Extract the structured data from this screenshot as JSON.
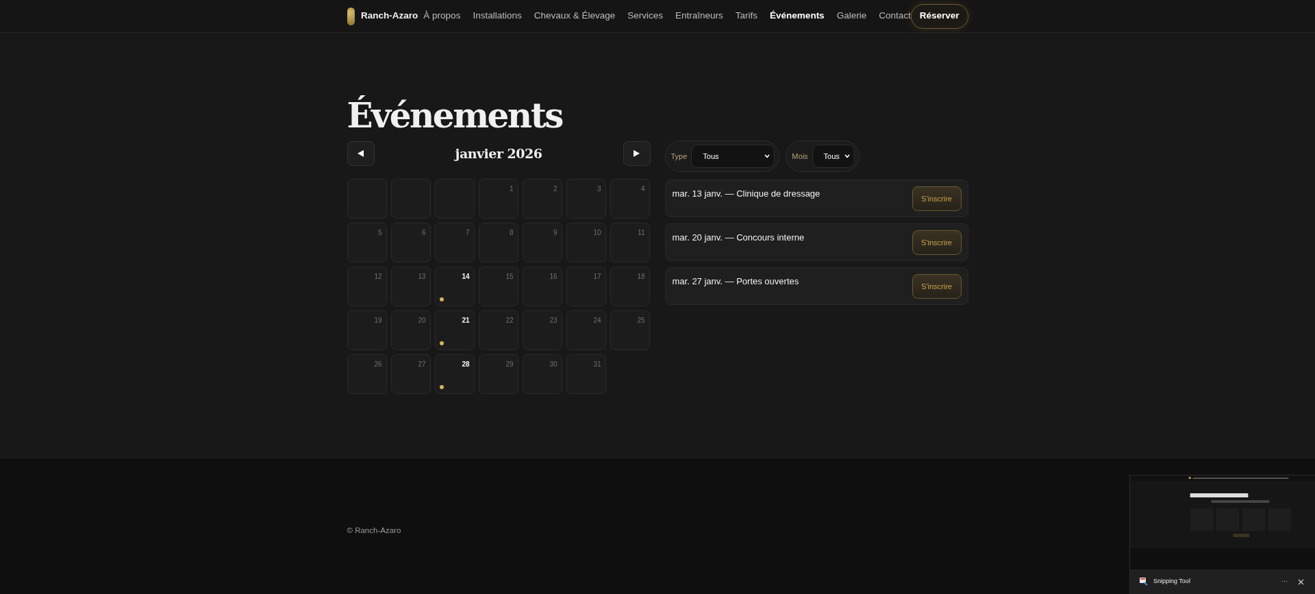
{
  "nav": {
    "brand": "Ranch-Azaro",
    "links": [
      {
        "label": "À propos",
        "selected": false
      },
      {
        "label": "Installations",
        "selected": false
      },
      {
        "label": "Chevaux & Élevage",
        "selected": false
      },
      {
        "label": "Services",
        "selected": false
      },
      {
        "label": "Entraîneurs",
        "selected": false
      },
      {
        "label": "Tarifs",
        "selected": false
      },
      {
        "label": "Événements",
        "selected": true
      },
      {
        "label": "Galerie",
        "selected": false
      },
      {
        "label": "Contact",
        "selected": false
      }
    ],
    "cta": "Réserver"
  },
  "title": "Événements",
  "calendar": {
    "month": "janvier 2026",
    "cells": [
      {
        "kind": "blank"
      },
      {
        "kind": "blank"
      },
      {
        "kind": "blank"
      },
      {
        "kind": "day",
        "day": "1",
        "event": false
      },
      {
        "kind": "day",
        "day": "2",
        "event": false
      },
      {
        "kind": "day",
        "day": "3",
        "event": false
      },
      {
        "kind": "day",
        "day": "4",
        "event": false
      },
      {
        "kind": "day",
        "day": "5",
        "event": false
      },
      {
        "kind": "day",
        "day": "6",
        "event": false
      },
      {
        "kind": "day",
        "day": "7",
        "event": false
      },
      {
        "kind": "day",
        "day": "8",
        "event": false
      },
      {
        "kind": "day",
        "day": "9",
        "event": false
      },
      {
        "kind": "day",
        "day": "10",
        "event": false
      },
      {
        "kind": "day",
        "day": "11",
        "event": false
      },
      {
        "kind": "day",
        "day": "12",
        "event": false
      },
      {
        "kind": "day",
        "day": "13",
        "event": false
      },
      {
        "kind": "day",
        "day": "14",
        "event": true
      },
      {
        "kind": "day",
        "day": "15",
        "event": false
      },
      {
        "kind": "day",
        "day": "16",
        "event": false
      },
      {
        "kind": "day",
        "day": "17",
        "event": false
      },
      {
        "kind": "day",
        "day": "18",
        "event": false
      },
      {
        "kind": "day",
        "day": "19",
        "event": false
      },
      {
        "kind": "day",
        "day": "20",
        "event": false
      },
      {
        "kind": "day",
        "day": "21",
        "event": true
      },
      {
        "kind": "day",
        "day": "22",
        "event": false
      },
      {
        "kind": "day",
        "day": "23",
        "event": false
      },
      {
        "kind": "day",
        "day": "24",
        "event": false
      },
      {
        "kind": "day",
        "day": "25",
        "event": false
      },
      {
        "kind": "day",
        "day": "26",
        "event": false
      },
      {
        "kind": "day",
        "day": "27",
        "event": false
      },
      {
        "kind": "day",
        "day": "28",
        "event": true
      },
      {
        "kind": "day",
        "day": "29",
        "event": false
      },
      {
        "kind": "day",
        "day": "30",
        "event": false
      },
      {
        "kind": "day",
        "day": "31",
        "event": false
      }
    ]
  },
  "filters": [
    {
      "label": "Type",
      "value": "Tous"
    },
    {
      "label": "Mois",
      "value": "Tous"
    }
  ],
  "events": [
    {
      "title": "mar. 13 janv. — Clinique de dressage",
      "action": "S'inscrire"
    },
    {
      "title": "mar. 20 janv. — Concours interne",
      "action": "S'inscrire"
    },
    {
      "title": "mar. 27 janv. — Portes ouvertes",
      "action": "S'inscrire"
    }
  ],
  "footer": "© Ranch-Azaro",
  "toast": {
    "app": "Snipping Tool",
    "more": "···"
  }
}
